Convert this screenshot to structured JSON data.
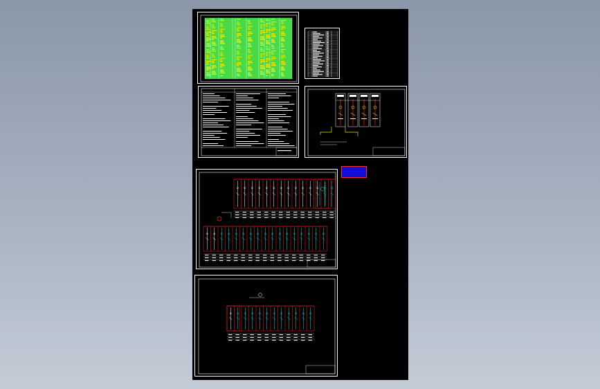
{
  "app": {
    "canvas_background": "#000000",
    "viewport_background": "#9aa6b6"
  },
  "drawing_colors": {
    "frame": "#ffffff",
    "table_fill": "#2fd42f",
    "table_line": "#ffffff",
    "text_yellow": "#f2f200",
    "text_white": "#ffffff",
    "bus_red": "#ff2020",
    "wire_cyan": "#18d8d8",
    "wire_yellow": "#f2e000",
    "tag_fill": "#1010d8",
    "tag_text": "#ff3030"
  },
  "tag": {
    "line1": "",
    "line2": ""
  },
  "sheets": {
    "cable_table": "cable-schedule-sheet",
    "equipment_list": "equipment-list-sheet",
    "notes": "design-notes-sheet",
    "hv_diagram": "hv-one-line-sheet",
    "lv_diagram": "lv-one-line-sheet",
    "lv_diagram_2": "lv-one-line-sheet-2"
  }
}
